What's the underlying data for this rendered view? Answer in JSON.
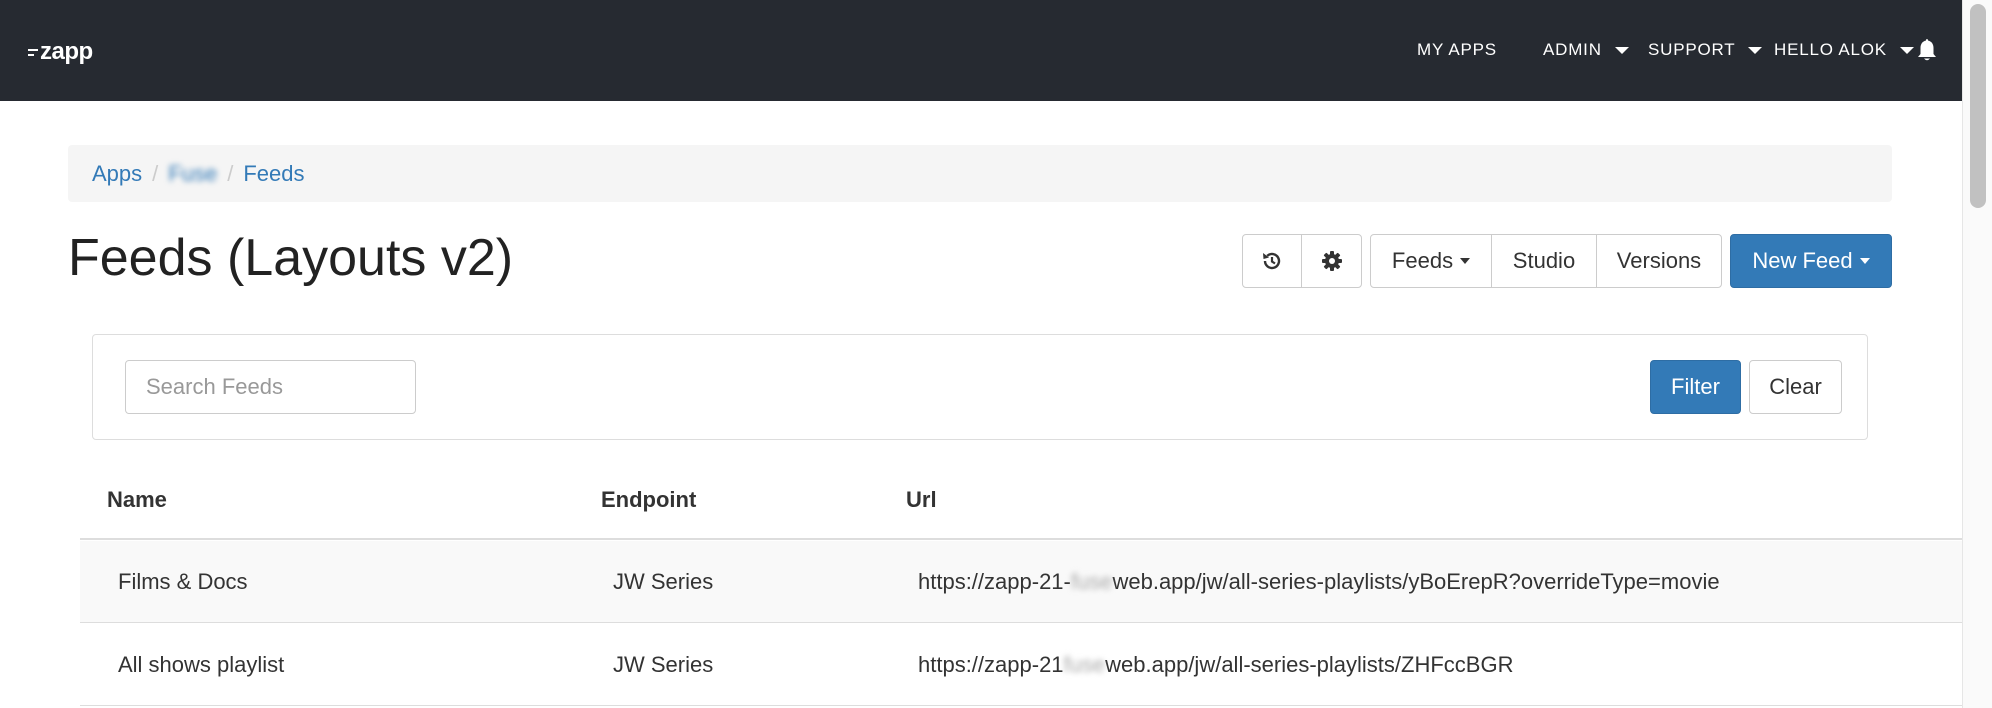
{
  "navbar": {
    "logo": "zapp",
    "my_apps": "MY APPS",
    "admin": "ADMIN",
    "support": "SUPPORT",
    "user": "HELLO ALOK"
  },
  "breadcrumb": {
    "apps": "Apps",
    "app_name": "Fuse",
    "feeds": "Feeds"
  },
  "page": {
    "title": "Feeds (Layouts v2)"
  },
  "toolbar": {
    "feeds_label": "Feeds",
    "studio_label": "Studio",
    "versions_label": "Versions",
    "new_feed_label": "New Feed"
  },
  "filter": {
    "search_placeholder": "Search Feeds",
    "filter_label": "Filter",
    "clear_label": "Clear"
  },
  "table": {
    "headers": [
      "Name",
      "Endpoint",
      "Url"
    ],
    "rows": [
      {
        "name": "Films & Docs",
        "endpoint": "JW Series",
        "url_prefix": "https://zapp-21-",
        "url_hidden": "fuse",
        "url_suffix": "web.app/jw/all-series-playlists/yBoErepR?overrideType=movie"
      },
      {
        "name": "All shows playlist",
        "endpoint": "JW Series",
        "url_prefix": "https://zapp-21",
        "url_hidden": "fuse",
        "url_suffix": "web.app/jw/all-series-playlists/ZHFccBGR"
      }
    ]
  }
}
